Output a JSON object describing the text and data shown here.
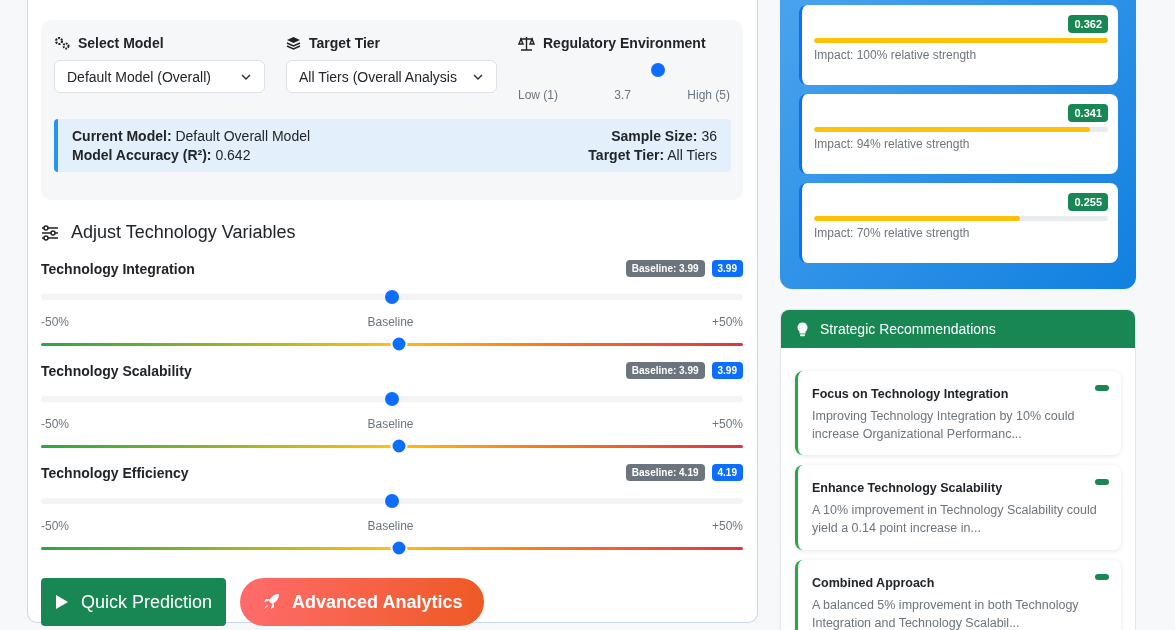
{
  "controls": {
    "model": {
      "label": "Select Model",
      "value": "Default Model (Overall)"
    },
    "tier": {
      "label": "Target Tier",
      "value": "All Tiers (Overall Analysis"
    },
    "regulatory": {
      "label": "Regulatory Environment",
      "level": 0.66,
      "min_label": "Low (1)",
      "value": "3.7",
      "max_label": "High (5)"
    }
  },
  "model_info": {
    "current_model": "**Current Model:** Default Overall Model",
    "accuracy": "**Model Accuracy (R²):** 0.642",
    "sample_size": "**Sample Size:** 36",
    "target_tier": "**Target Tier:** All Tiers"
  },
  "variables_title": "Adjust Technology Variables",
  "variables": [
    {
      "name": "Technology Integration",
      "baseline": "Baseline: 3.99",
      "value": "3.99",
      "min_label": "-50%",
      "mid_label": "Baseline",
      "max_label": "+50%",
      "sliders": [
        {
          "kind": "plain",
          "level": 0.5
        },
        {
          "kind": "gradient",
          "level": 0.51
        }
      ]
    },
    {
      "name": "Technology Scalability",
      "baseline": "Baseline: 3.99",
      "value": "3.99",
      "min_label": "-50%",
      "mid_label": "Baseline",
      "max_label": "+50%",
      "sliders": [
        {
          "kind": "plain",
          "level": 0.5
        },
        {
          "kind": "gradient",
          "level": 0.51
        }
      ]
    },
    {
      "name": "Technology Efficiency",
      "baseline": "Baseline: 4.19",
      "value": "4.19",
      "min_label": "-50%",
      "mid_label": "Baseline",
      "max_label": "+50%",
      "sliders": [
        {
          "kind": "plain",
          "level": 0.5
        },
        {
          "kind": "gradient",
          "level": 0.51
        }
      ]
    }
  ],
  "buttons": [
    {
      "kind": "quick",
      "label": "Quick Prediction"
    },
    {
      "kind": "advanced",
      "label": "Advanced Analytics"
    }
  ],
  "impacts": [
    {
      "value": "0.362",
      "level": 1.0,
      "text": "Impact: 100% relative strength"
    },
    {
      "value": "0.341",
      "level": 0.94,
      "text": "Impact: 94% relative strength"
    },
    {
      "value": "0.255",
      "level": 0.7,
      "text": "Impact: 70% relative strength"
    }
  ],
  "recommendations": {
    "title": "Strategic Recommendations",
    "items": [
      {
        "title": "Focus on Technology Integration",
        "text": "Improving Technology Integration by 10% could increase Organizational Performanc..."
      },
      {
        "title": "Enhance Technology Scalability",
        "text": "A 10% improvement in Technology Scalability could yield a 0.14 point increase in..."
      },
      {
        "title": "Combined Approach",
        "text": "A balanced 5% improvement in both Technology Integration and Technology Scalabil..."
      }
    ]
  }
}
